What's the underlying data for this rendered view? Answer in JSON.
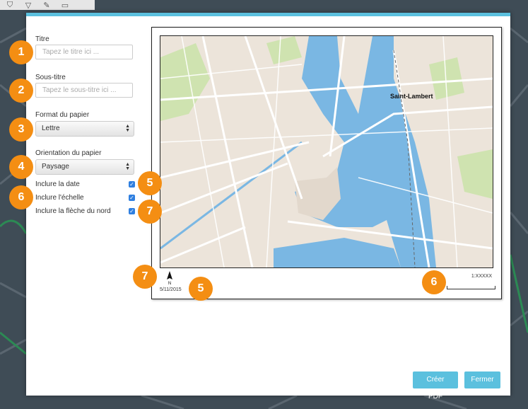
{
  "toolbar": {
    "tools": [
      {
        "icon": "stamp-icon",
        "glyph": "⛉"
      },
      {
        "icon": "filter-icon",
        "glyph": "▽"
      },
      {
        "icon": "pencil-icon",
        "glyph": "✎"
      },
      {
        "icon": "print-icon",
        "glyph": "▭"
      }
    ]
  },
  "form": {
    "title_label": "Titre",
    "title_value": "",
    "title_placeholder": "Tapez le titre ici ...",
    "subtitle_label": "Sous-titre",
    "subtitle_value": "",
    "subtitle_placeholder": "Tapez le sous-titre ici ...",
    "paper_format_label": "Format du papier",
    "paper_format_value": "Lettre",
    "orientation_label": "Orientation du papier",
    "orientation_value": "Paysage",
    "include_date_label": "Inclure la date",
    "include_date_checked": true,
    "include_scale_label": "Inclure l'échelle",
    "include_scale_checked": true,
    "include_north_label": "Inclure la flèche du nord",
    "include_north_checked": true
  },
  "badges": [
    "1",
    "2",
    "3",
    "4",
    "5",
    "6",
    "7",
    "7",
    "5",
    "6"
  ],
  "preview": {
    "city_label": "Saint-Lambert",
    "north_letter": "N",
    "date": "5/11/2015",
    "scale_text": "1:XXXXX"
  },
  "buttons": {
    "create_pdf": "Créer PDF",
    "close": "Fermer"
  },
  "colors": {
    "accent": "#5bc0de",
    "badge": "#f48e13",
    "water": "#7ab7e3",
    "land": "#ece4da",
    "park": "#cfe3b0",
    "checkbox": "#2f7fe0"
  }
}
